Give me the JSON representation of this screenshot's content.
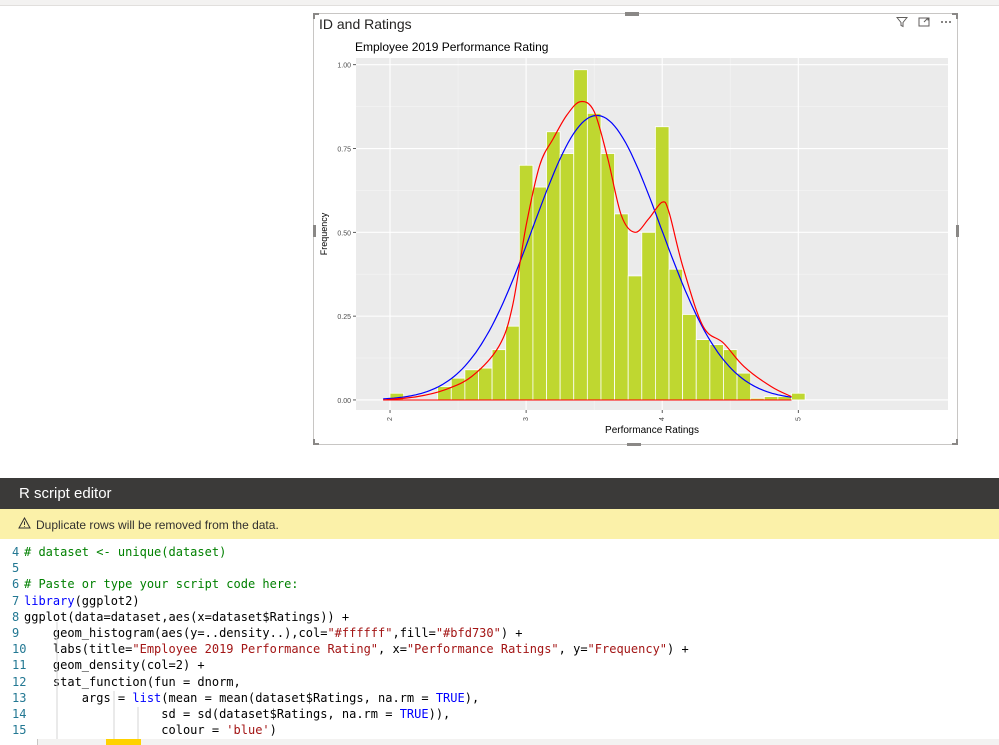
{
  "visual": {
    "title": "ID and Ratings"
  },
  "chart_data": {
    "type": "bar",
    "title": "Employee 2019 Performance Rating",
    "xlabel": "Performance Ratings",
    "ylabel": "Frequency",
    "xlim": [
      1.75,
      6.1
    ],
    "ylim": [
      -0.03,
      1.02
    ],
    "x_ticks": [
      "2",
      "3",
      "4",
      "5"
    ],
    "y_ticks": [
      "0.00",
      "0.25",
      "0.50",
      "0.75",
      "1.00"
    ],
    "bar_fill": "#bfd730",
    "bar_outline": "#ffffff",
    "grid": true,
    "bins": [
      {
        "x0": 2.0,
        "x1": 2.1,
        "value": 0.02
      },
      {
        "x0": 2.35,
        "x1": 2.45,
        "value": 0.04
      },
      {
        "x0": 2.45,
        "x1": 2.55,
        "value": 0.065
      },
      {
        "x0": 2.55,
        "x1": 2.65,
        "value": 0.09
      },
      {
        "x0": 2.65,
        "x1": 2.75,
        "value": 0.095
      },
      {
        "x0": 2.75,
        "x1": 2.85,
        "value": 0.15
      },
      {
        "x0": 2.85,
        "x1": 2.95,
        "value": 0.22
      },
      {
        "x0": 2.95,
        "x1": 3.05,
        "value": 0.7
      },
      {
        "x0": 3.05,
        "x1": 3.15,
        "value": 0.635
      },
      {
        "x0": 3.15,
        "x1": 3.25,
        "value": 0.8
      },
      {
        "x0": 3.25,
        "x1": 3.35,
        "value": 0.735
      },
      {
        "x0": 3.35,
        "x1": 3.45,
        "value": 0.985
      },
      {
        "x0": 3.45,
        "x1": 3.55,
        "value": 0.855
      },
      {
        "x0": 3.55,
        "x1": 3.65,
        "value": 0.735
      },
      {
        "x0": 3.65,
        "x1": 3.75,
        "value": 0.555
      },
      {
        "x0": 3.75,
        "x1": 3.85,
        "value": 0.37
      },
      {
        "x0": 3.85,
        "x1": 3.95,
        "value": 0.5
      },
      {
        "x0": 3.95,
        "x1": 4.05,
        "value": 0.815
      },
      {
        "x0": 4.05,
        "x1": 4.15,
        "value": 0.39
      },
      {
        "x0": 4.15,
        "x1": 4.25,
        "value": 0.255
      },
      {
        "x0": 4.25,
        "x1": 4.35,
        "value": 0.18
      },
      {
        "x0": 4.35,
        "x1": 4.45,
        "value": 0.165
      },
      {
        "x0": 4.45,
        "x1": 4.55,
        "value": 0.15
      },
      {
        "x0": 4.55,
        "x1": 4.65,
        "value": 0.08
      },
      {
        "x0": 4.65,
        "x1": 4.75,
        "value": 0.005
      },
      {
        "x0": 4.75,
        "x1": 4.85,
        "value": 0.01
      },
      {
        "x0": 4.85,
        "x1": 4.95,
        "value": 0.01
      },
      {
        "x0": 4.95,
        "x1": 5.05,
        "value": 0.02
      }
    ],
    "normal_curve": {
      "color": "blue",
      "mean": 3.52,
      "sd": 0.47
    },
    "density_curve": {
      "color": "red",
      "points": [
        [
          1.95,
          0.0
        ],
        [
          2.2,
          0.01
        ],
        [
          2.4,
          0.03
        ],
        [
          2.6,
          0.07
        ],
        [
          2.8,
          0.16
        ],
        [
          2.9,
          0.28
        ],
        [
          3.0,
          0.52
        ],
        [
          3.1,
          0.7
        ],
        [
          3.2,
          0.78
        ],
        [
          3.3,
          0.85
        ],
        [
          3.4,
          0.89
        ],
        [
          3.5,
          0.86
        ],
        [
          3.6,
          0.72
        ],
        [
          3.7,
          0.55
        ],
        [
          3.8,
          0.5
        ],
        [
          3.9,
          0.54
        ],
        [
          4.0,
          0.59
        ],
        [
          4.05,
          0.56
        ],
        [
          4.15,
          0.4
        ],
        [
          4.3,
          0.22
        ],
        [
          4.45,
          0.17
        ],
        [
          4.6,
          0.1
        ],
        [
          4.8,
          0.04
        ],
        [
          4.95,
          0.01
        ]
      ]
    }
  },
  "editor": {
    "title": "R script editor",
    "warning": "Duplicate rows will be removed from the data.",
    "lines": [
      {
        "n": "4",
        "segs": [
          {
            "t": "# dataset <- unique(dataset)",
            "c": "c-cmt"
          }
        ]
      },
      {
        "n": "5",
        "segs": []
      },
      {
        "n": "6",
        "segs": [
          {
            "t": "# Paste or type your script code here:",
            "c": "c-cmt"
          }
        ]
      },
      {
        "n": "7",
        "segs": [
          {
            "t": "library",
            "c": "c-kw"
          },
          {
            "t": "(ggplot2)",
            "c": ""
          }
        ]
      },
      {
        "n": "8",
        "segs": [
          {
            "t": "ggplot(data=dataset,aes(x=dataset$Ratings)) +",
            "c": ""
          }
        ]
      },
      {
        "n": "9",
        "segs": [
          {
            "t": "    geom_histogram(aes(y=..density..),col=",
            "c": ""
          },
          {
            "t": "\"#ffffff\"",
            "c": "c-str"
          },
          {
            "t": ",fill=",
            "c": ""
          },
          {
            "t": "\"#bfd730\"",
            "c": "c-str"
          },
          {
            "t": ") +",
            "c": ""
          }
        ]
      },
      {
        "n": "10",
        "segs": [
          {
            "t": "    labs(title=",
            "c": ""
          },
          {
            "t": "\"Employee 2019 Performance Rating\"",
            "c": "c-str"
          },
          {
            "t": ", x=",
            "c": ""
          },
          {
            "t": "\"Performance Ratings\"",
            "c": "c-str"
          },
          {
            "t": ", y=",
            "c": ""
          },
          {
            "t": "\"Frequency\"",
            "c": "c-str"
          },
          {
            "t": ") +",
            "c": ""
          }
        ]
      },
      {
        "n": "11",
        "segs": [
          {
            "t": "    geom_density(col=2) +",
            "c": ""
          }
        ]
      },
      {
        "n": "12",
        "segs": [
          {
            "t": "    stat_function(fun = dnorm,",
            "c": ""
          }
        ]
      },
      {
        "n": "13",
        "segs": [
          {
            "t": "        args = ",
            "c": ""
          },
          {
            "t": "list",
            "c": "c-kw"
          },
          {
            "t": "(mean = mean(dataset$Ratings, na.rm = ",
            "c": ""
          },
          {
            "t": "TRUE",
            "c": "c-kw"
          },
          {
            "t": "),",
            "c": ""
          }
        ]
      },
      {
        "n": "14",
        "segs": [
          {
            "t": "                   sd = sd(dataset$Ratings, na.rm = ",
            "c": ""
          },
          {
            "t": "TRUE",
            "c": "c-kw"
          },
          {
            "t": ")),",
            "c": ""
          }
        ]
      },
      {
        "n": "15",
        "segs": [
          {
            "t": "                   colour = ",
            "c": ""
          },
          {
            "t": "'blue'",
            "c": "c-str"
          },
          {
            "t": ")",
            "c": ""
          }
        ]
      }
    ]
  }
}
